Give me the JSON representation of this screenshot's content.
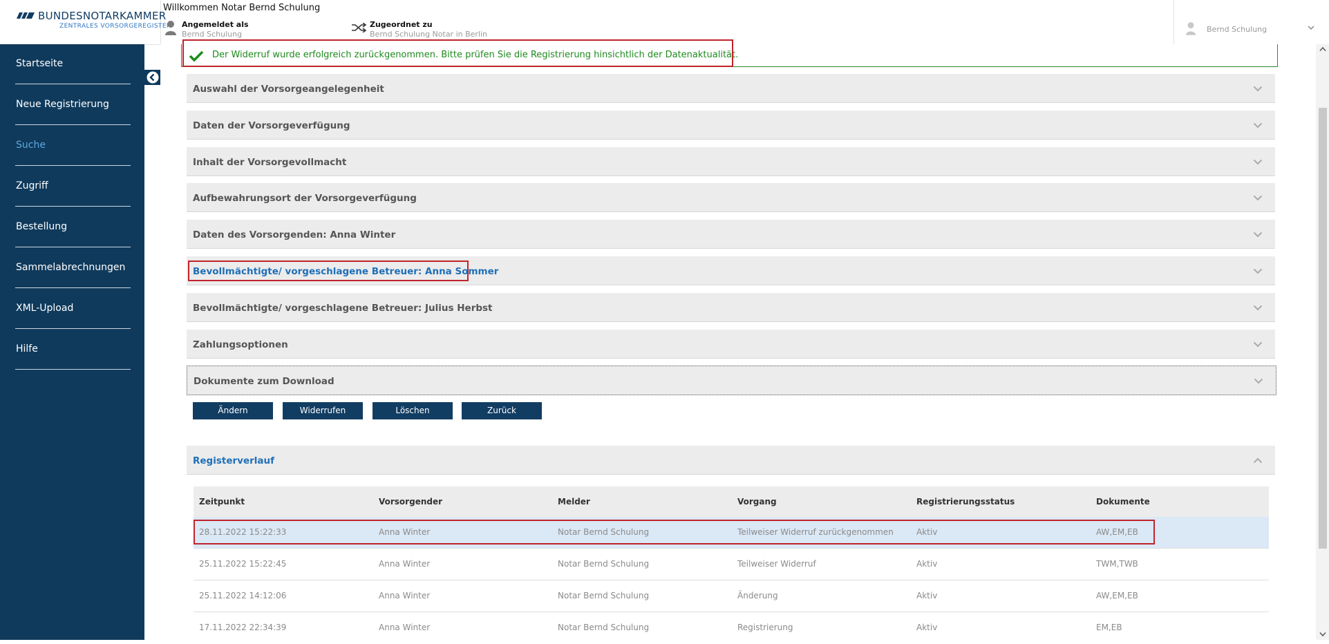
{
  "header": {
    "logo_name": "BUNDESNOTARKAMMER",
    "logo_sub": "ZENTRALES VORSORGEREGISTER",
    "welcome": "Willkommen Notar Bernd Schulung",
    "logged_in_label": "Angemeldet als",
    "logged_in_value": "Bernd Schulung",
    "assigned_label": "Zugeordnet zu",
    "assigned_value": "Bernd Schulung Notar in Berlin",
    "user_menu_name": "Bernd Schulung"
  },
  "sidebar": {
    "items": [
      {
        "label": "Startseite"
      },
      {
        "label": "Neue Registrierung"
      },
      {
        "label": "Suche"
      },
      {
        "label": "Zugriff"
      },
      {
        "label": "Bestellung"
      },
      {
        "label": "Sammelabrechnungen"
      },
      {
        "label": "XML-Upload"
      },
      {
        "label": "Hilfe"
      }
    ]
  },
  "alert": {
    "message": "Der Widerruf wurde erfolgreich zurückgenommen. Bitte prüfen Sie die Registrierung hinsichtlich der Datenaktualität."
  },
  "sections": [
    {
      "title": "Auswahl der Vorsorgeangelegenheit"
    },
    {
      "title": "Daten der Vorsorgeverfügung"
    },
    {
      "title": "Inhalt der Vorsorgevollmacht"
    },
    {
      "title": "Aufbewahrungsort der Vorsorgeverfügung"
    },
    {
      "title": "Daten des Vorsorgenden: Anna Winter"
    },
    {
      "title": "Bevollmächtigte/ vorgeschlagene Betreuer: Anna Sommer"
    },
    {
      "title": "Bevollmächtigte/ vorgeschlagene Betreuer: Julius Herbst"
    },
    {
      "title": "Zahlungsoptionen"
    },
    {
      "title": "Dokumente zum Download"
    }
  ],
  "actions": {
    "edit": "Ändern",
    "revoke": "Widerrufen",
    "delete": "Löschen",
    "back": "Zurück"
  },
  "register": {
    "title": "Registerverlauf",
    "columns": [
      "Zeitpunkt",
      "Vorsorgender",
      "Melder",
      "Vorgang",
      "Registrierungsstatus",
      "Dokumente"
    ],
    "rows": [
      [
        "28.11.2022 15:22:33",
        "Anna Winter",
        "Notar Bernd Schulung",
        "Teilweiser Widerruf zurückgenommen",
        "Aktiv",
        "AW,EM,EB"
      ],
      [
        "25.11.2022 15:22:45",
        "Anna Winter",
        "Notar Bernd Schulung",
        "Teilweiser Widerruf",
        "Aktiv",
        "TWM,TWB"
      ],
      [
        "25.11.2022 14:12:06",
        "Anna Winter",
        "Notar Bernd Schulung",
        "Änderung",
        "Aktiv",
        "AW,EM,EB"
      ],
      [
        "17.11.2022 22:34:39",
        "Anna Winter",
        "Notar Bernd Schulung",
        "Registrierung",
        "Aktiv",
        "EM,EB"
      ]
    ]
  },
  "colors": {
    "sidebar_bg": "#0f3a5c",
    "nav_active": "#5fa8e0",
    "success": "#1e8a1e",
    "link_blue": "#1f6fb8",
    "highlight_red": "#c0232b",
    "row_highlight": "#dbe8f5"
  },
  "icons": {
    "logo": "bnotk-stripes-icon",
    "user": "user-icon",
    "assigned": "shuffle-icon",
    "collapse": "chevron-left-circle-icon",
    "success": "checkmark-icon",
    "accordion": "chevron-down-icon",
    "accordion_open": "chevron-up-icon"
  }
}
